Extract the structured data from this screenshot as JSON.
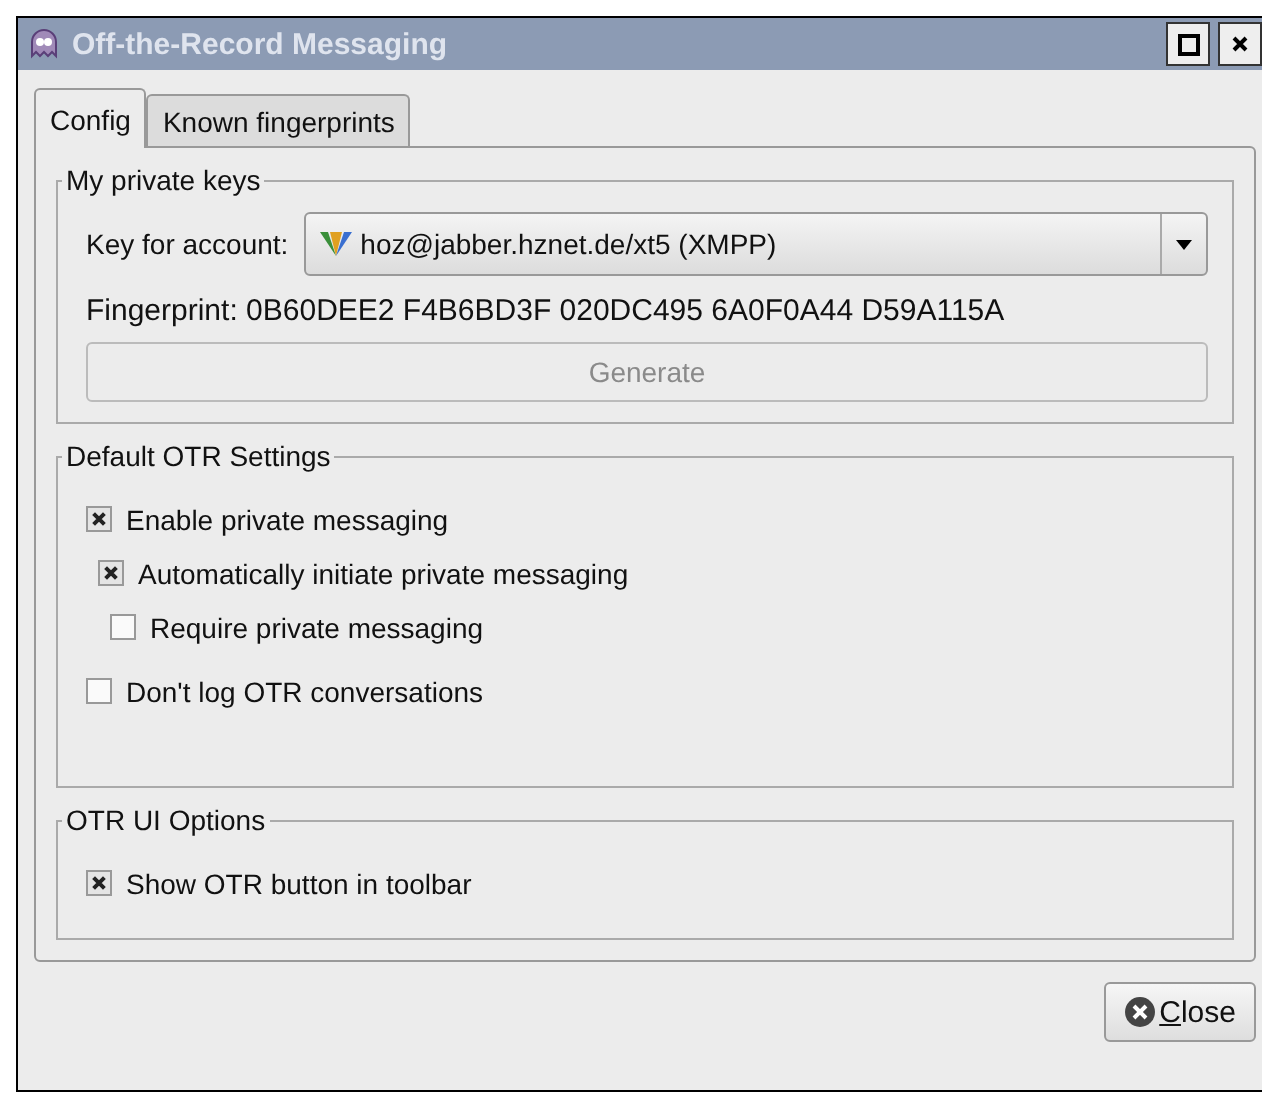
{
  "window": {
    "title": "Off-the-Record Messaging"
  },
  "tabs": [
    {
      "label": "Config",
      "selected": true
    },
    {
      "label": "Known fingerprints",
      "selected": false
    }
  ],
  "private_keys": {
    "title": "My private keys",
    "account_label": "Key for account:",
    "account_value": "hoz@jabber.hznet.de/xt5 (XMPP)",
    "fingerprint": "Fingerprint: 0B60DEE2 F4B6BD3F 020DC495 6A0F0A44 D59A115A",
    "generate": {
      "label": "Generate",
      "disabled": true
    }
  },
  "default_settings": {
    "title": "Default OTR Settings",
    "options": [
      {
        "label": "Enable private messaging",
        "checked": true,
        "children": [
          {
            "label": "Automatically initiate private messaging",
            "checked": true,
            "children": [
              {
                "label": "Require private messaging",
                "checked": false
              }
            ]
          }
        ]
      },
      {
        "label": "Don't log OTR conversations",
        "checked": false
      }
    ]
  },
  "ui_options": {
    "title": "OTR UI Options",
    "options": [
      {
        "label": "Show OTR button in toolbar",
        "checked": true
      }
    ]
  },
  "buttons": {
    "close": "Close"
  }
}
